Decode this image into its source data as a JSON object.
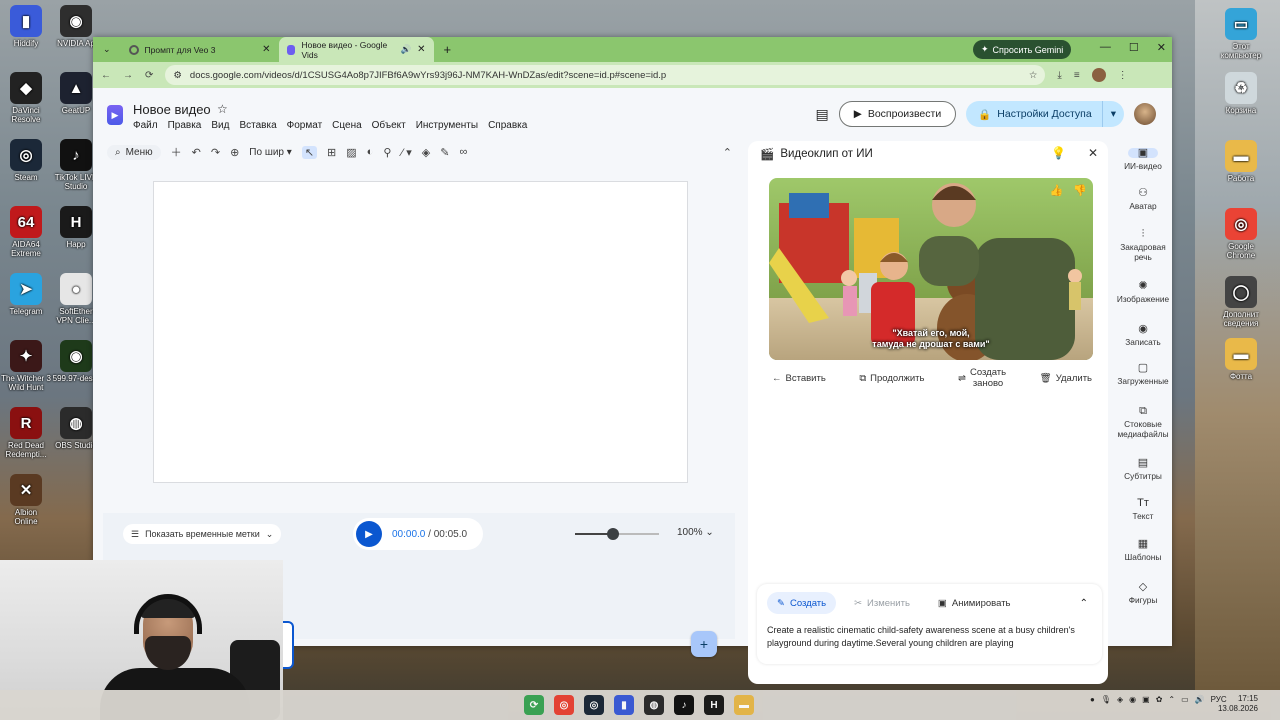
{
  "desktop": {
    "left_icons": [
      {
        "label": "Hiddify",
        "icon": "hiddify-icon",
        "color": "#3a5bd9",
        "glyph": "▮"
      },
      {
        "label": "NVIDIA Ap",
        "icon": "nvidia-icon",
        "color": "#2e2e2e",
        "glyph": "◉"
      },
      {
        "label": "DaVinci\nResolve",
        "icon": "davinci-icon",
        "color": "#222",
        "glyph": "◆"
      },
      {
        "label": "GeatUP",
        "icon": "geatup-icon",
        "color": "#1d2230",
        "glyph": "▲"
      },
      {
        "label": "Steam",
        "icon": "steam-icon",
        "color": "#1b2838",
        "glyph": "◎"
      },
      {
        "label": "TikTok LIVE\nStudio",
        "icon": "tiktok-icon",
        "color": "#111",
        "glyph": "♪"
      },
      {
        "label": "AIDA64\nExtreme",
        "icon": "aida64-icon",
        "color": "#c0191b",
        "glyph": "64"
      },
      {
        "label": "Happ",
        "icon": "happ-icon",
        "color": "#1a1a1a",
        "glyph": "H"
      },
      {
        "label": "Telegram",
        "icon": "telegram-icon",
        "color": "#2aa3df",
        "glyph": "➤"
      },
      {
        "label": "SoftEther\nVPN Clie...",
        "icon": "softether-icon",
        "color": "#e6e6e6",
        "glyph": "●"
      },
      {
        "label": "The Witcher 3\nWild Hunt",
        "icon": "witcher-icon",
        "color": "#3b1818",
        "glyph": "✦"
      },
      {
        "label": "599.97-des...",
        "icon": "nvidia-driver-icon",
        "color": "#1e3a1a",
        "glyph": "◉"
      },
      {
        "label": "Red Dead\nRedempti...",
        "icon": "rdr-icon",
        "color": "#8a1010",
        "glyph": "R"
      },
      {
        "label": "OBS Studio",
        "icon": "obs-icon",
        "color": "#2b2b2b",
        "glyph": "◍"
      },
      {
        "label": "Albion\nOnline",
        "icon": "albion-icon",
        "color": "#5a3a22",
        "glyph": "✕"
      }
    ],
    "right_icons": [
      {
        "label": "Этот\nкомпьютер",
        "icon": "computer-icon",
        "color": "#34a4d8",
        "glyph": "▭"
      },
      {
        "label": "Корзина",
        "icon": "recycle-bin-icon",
        "color": "#cfd8dc",
        "glyph": "♻"
      },
      {
        "label": "Работа",
        "icon": "folder-icon",
        "color": "#e9b949",
        "glyph": "▬"
      },
      {
        "label": "Google\nChrome",
        "icon": "chrome-icon",
        "color": "#ea4335",
        "glyph": "◎"
      },
      {
        "label": "Дополнит\nсведения",
        "icon": "info-icon",
        "color": "#444",
        "glyph": "◯"
      },
      {
        "label": "Фотта",
        "icon": "folder-icon",
        "color": "#e9b949",
        "glyph": "▬"
      }
    ]
  },
  "browser": {
    "tabs": [
      {
        "title": "Промпт для Veo 3",
        "active": false
      },
      {
        "title": "Новое видео - Google Vids",
        "active": true
      }
    ],
    "ask_gemini": "Спросить Gemini",
    "url": "docs.google.com/videos/d/1CSUSG4Ao8p7JIFBf6A9wYrs93j96J-NM7KAH-WnDZas/edit?scene=id.p#scene=id.p"
  },
  "app": {
    "doc_title": "Новое видео",
    "menu": [
      "Файл",
      "Правка",
      "Вид",
      "Вставка",
      "Формат",
      "Сцена",
      "Объект",
      "Инструменты",
      "Справка"
    ],
    "play_button": "Воспроизвести",
    "share_button": "Настройки Доступа",
    "toolbar": {
      "search": "Меню",
      "fit": "По шир"
    },
    "timeline": {
      "show_timestamps": "Показать временные метки",
      "current_time": "00:00.0",
      "separator": "/",
      "total_time": "00:05.0",
      "zoom": "100%"
    }
  },
  "ai_panel": {
    "title": "Видеоклип от ИИ",
    "caption": "\"Хватай его, мой,\nтамуда не дрошат с вами\"",
    "actions": {
      "insert": "Вставить",
      "continue": "Продолжить",
      "regenerate": "Создать\nзаново",
      "delete": "Удалить"
    },
    "prompt_tabs": {
      "create": "Создать",
      "edit": "Изменить",
      "animate": "Анимировать"
    },
    "prompt_text": "Create a realistic cinematic child-safety awareness scene at a busy children's playground during daytime.Several young children are playing"
  },
  "rail": [
    {
      "label": "ИИ-видео",
      "icon": "ai-video-icon",
      "glyph": "▣",
      "active": true
    },
    {
      "label": "Аватар",
      "icon": "avatar-add-icon",
      "glyph": "⚇",
      "active": false
    },
    {
      "label": "Закадровая\nречь",
      "icon": "voiceover-icon",
      "glyph": "⫶",
      "active": false
    },
    {
      "label": "Изображение",
      "icon": "image-gen-icon",
      "glyph": "✺",
      "active": false
    },
    {
      "label": "Записать",
      "icon": "record-icon",
      "glyph": "◉",
      "active": false
    },
    {
      "label": "Загруженные",
      "icon": "folder-outline-icon",
      "glyph": "▢",
      "active": false
    },
    {
      "label": "Стоковые\nмедиафайлы",
      "icon": "stock-media-icon",
      "glyph": "⧉",
      "active": false
    },
    {
      "label": "Субтитры",
      "icon": "subtitles-icon",
      "glyph": "▤",
      "active": false
    },
    {
      "label": "Текст",
      "icon": "text-icon",
      "glyph": "Tт",
      "active": false
    },
    {
      "label": "Шаблоны",
      "icon": "templates-icon",
      "glyph": "▦",
      "active": false
    },
    {
      "label": "Фигуры",
      "icon": "shapes-icon",
      "glyph": "◇",
      "active": false
    }
  ],
  "taskbar": {
    "apps": [
      {
        "icon": "taskbar-refresh-icon",
        "color": "#3aa655",
        "glyph": "⟳"
      },
      {
        "icon": "taskbar-chrome-icon",
        "color": "#ea4335",
        "glyph": "◎"
      },
      {
        "icon": "taskbar-steam-icon",
        "color": "#1b2838",
        "glyph": "◎"
      },
      {
        "icon": "taskbar-hiddify-icon",
        "color": "#3a5bd9",
        "glyph": "▮"
      },
      {
        "icon": "taskbar-obs-icon",
        "color": "#2b2b2b",
        "glyph": "◍"
      },
      {
        "icon": "taskbar-tiktok-icon",
        "color": "#111",
        "glyph": "♪"
      },
      {
        "icon": "taskbar-happ-icon",
        "color": "#1a1a1a",
        "glyph": "H"
      },
      {
        "icon": "taskbar-explorer-icon",
        "color": "#e9b949",
        "glyph": "▬"
      }
    ],
    "language": "РУС",
    "time": "17:15",
    "date": "13.08.2026"
  }
}
